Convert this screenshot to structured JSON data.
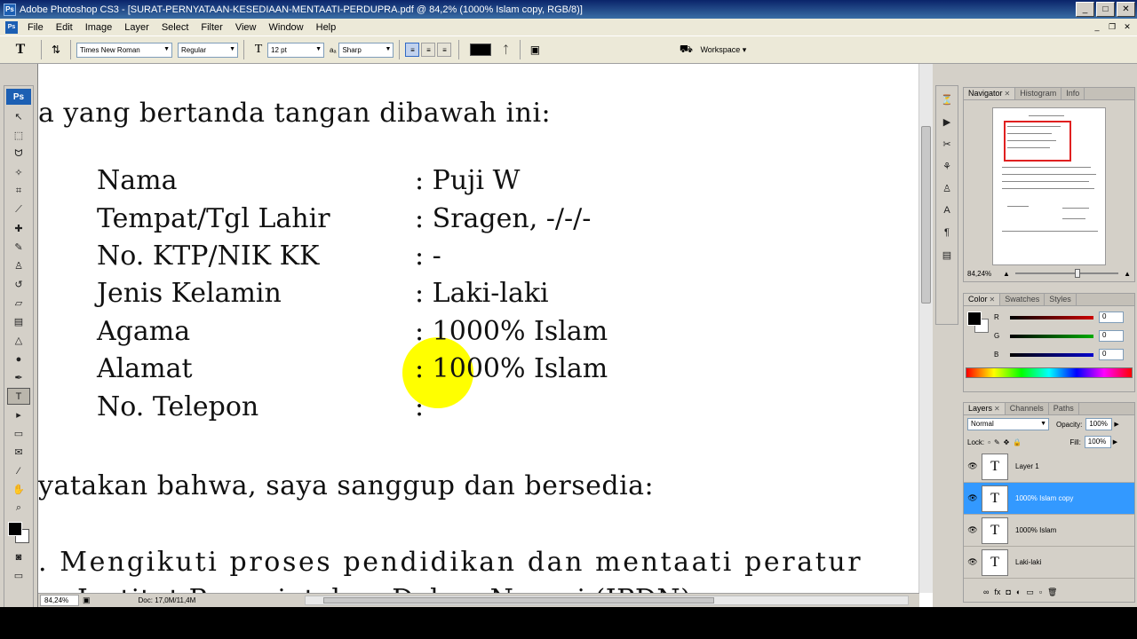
{
  "window": {
    "title": "Adobe Photoshop CS3 - [SURAT-PERNYATAAN-KESEDIAAN-MENTAATI-PERDUPRA.pdf @ 84,2% (1000% Islam copy, RGB/8)]",
    "minimize": "_",
    "maximize": "□",
    "close": "✕"
  },
  "menu": [
    "File",
    "Edit",
    "Image",
    "Layer",
    "Select",
    "Filter",
    "View",
    "Window",
    "Help"
  ],
  "options": {
    "tool_glyph": "T",
    "font_family": "Times New Roman",
    "font_style": "Regular",
    "font_size": "12 pt",
    "antialias": "Sharp",
    "antialias_prefix": "aₐ",
    "workspace": "Workspace ▾",
    "text_color": "#000000"
  },
  "tools": [
    {
      "name": "move-tool",
      "glyph": "↖"
    },
    {
      "name": "marquee-tool",
      "glyph": "⬚"
    },
    {
      "name": "lasso-tool",
      "glyph": "ᗢ"
    },
    {
      "name": "magic-wand-tool",
      "glyph": "✧"
    },
    {
      "name": "crop-tool",
      "glyph": "⌗"
    },
    {
      "name": "slice-tool",
      "glyph": "⟋"
    },
    {
      "name": "healing-tool",
      "glyph": "✚"
    },
    {
      "name": "brush-tool",
      "glyph": "✎"
    },
    {
      "name": "clone-stamp-tool",
      "glyph": "♙"
    },
    {
      "name": "history-brush-tool",
      "glyph": "↺"
    },
    {
      "name": "eraser-tool",
      "glyph": "▱"
    },
    {
      "name": "gradient-tool",
      "glyph": "▤"
    },
    {
      "name": "blur-tool",
      "glyph": "△"
    },
    {
      "name": "dodge-tool",
      "glyph": "●"
    },
    {
      "name": "pen-tool",
      "glyph": "✒"
    },
    {
      "name": "type-tool",
      "glyph": "T"
    },
    {
      "name": "path-selection-tool",
      "glyph": "▸"
    },
    {
      "name": "shape-tool",
      "glyph": "▭"
    },
    {
      "name": "notes-tool",
      "glyph": "✉"
    },
    {
      "name": "eyedropper-tool",
      "glyph": "⁄"
    },
    {
      "name": "hand-tool",
      "glyph": "✋"
    },
    {
      "name": "zoom-tool",
      "glyph": "⌕"
    }
  ],
  "document": {
    "line1": "a yang bertanda tangan dibawah ini:",
    "fields": [
      {
        "label": "Nama",
        "value": ": Puji W"
      },
      {
        "label": "Tempat/Tgl Lahir",
        "value": ": Sragen, -/-/-"
      },
      {
        "label": "No. KTP/NIK KK",
        "value": ": -"
      },
      {
        "label": "Jenis Kelamin",
        "value": ": Laki-laki"
      },
      {
        "label": "Agama",
        "value": ": 1000% Islam"
      },
      {
        "label": "Alamat",
        "value": ": 1000% Islam"
      },
      {
        "label": "No. Telepon",
        "value": ":"
      }
    ],
    "line2": "yatakan bahwa, saya sanggup dan bersedia:",
    "line3": ".  Mengikuti proses pendidikan dan mentaati peratur",
    "line4": "Institut Pemerintahan Dalam Negeri (IPDN)",
    "highlight_color": "#ffff00"
  },
  "status": {
    "zoom": "84,24%",
    "doc_info": "Doc: 17,0M/11,4M"
  },
  "navigator": {
    "tabs": [
      "Navigator",
      "Histogram",
      "Info"
    ],
    "zoom": "84,24%"
  },
  "color_panel": {
    "tabs": [
      "Color",
      "Swatches",
      "Styles"
    ],
    "channels": [
      {
        "label": "R",
        "value": "0",
        "color": "#cc0000"
      },
      {
        "label": "G",
        "value": "0",
        "color": "#00aa00"
      },
      {
        "label": "B",
        "value": "0",
        "color": "#0000cc"
      }
    ]
  },
  "layers_panel": {
    "tabs": [
      "Layers",
      "Channels",
      "Paths"
    ],
    "blend_mode": "Normal",
    "opacity_label": "Opacity:",
    "opacity": "100%",
    "lock_label": "Lock:",
    "fill_label": "Fill:",
    "fill": "100%",
    "layers": [
      {
        "name": "Layer 1",
        "selected": false
      },
      {
        "name": "1000% Islam copy",
        "selected": true
      },
      {
        "name": "1000% Islam",
        "selected": false
      },
      {
        "name": "Laki-laki",
        "selected": false
      }
    ],
    "footer_icons": [
      "∞",
      "fx",
      "◘",
      "◐",
      "▭",
      "▫",
      "🗑"
    ]
  }
}
